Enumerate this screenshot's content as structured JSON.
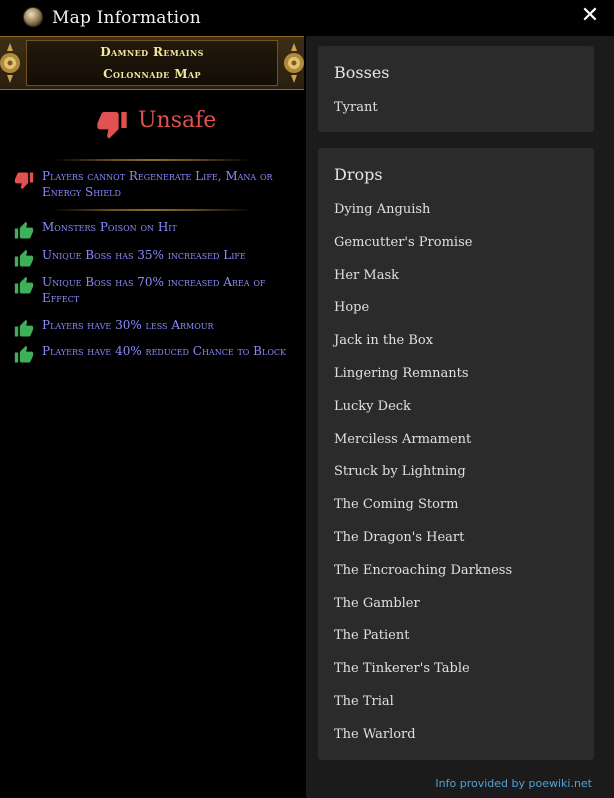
{
  "window": {
    "title": "Map Information",
    "close_glyph": "✕"
  },
  "map": {
    "name": "Damned Remains",
    "type": "Colonnade Map"
  },
  "rating": {
    "label": "Unsafe",
    "icon": "thumbs-down-icon",
    "color": "#e05252"
  },
  "modifiers": [
    {
      "text": "Players cannot Regenerate Life, Mana or Energy Shield",
      "verdict": "bad"
    },
    {
      "text": "Monsters Poison on Hit",
      "verdict": "good"
    },
    {
      "text": "Unique Boss has 35% increased Life",
      "verdict": "good"
    },
    {
      "text": "Unique Boss has 70% increased Area of Effect",
      "verdict": "good"
    },
    {
      "text": "Players have 30% less Armour",
      "verdict": "good"
    },
    {
      "text": "Players have 40% reduced Chance to Block",
      "verdict": "good"
    }
  ],
  "colors": {
    "bad": "#e05252",
    "good": "#3fb05a",
    "modifier_text": "#8a8aff",
    "footer_link": "#4fa3d8"
  },
  "bosses": {
    "heading": "Bosses",
    "items": [
      "Tyrant"
    ]
  },
  "drops": {
    "heading": "Drops",
    "items": [
      "Dying Anguish",
      "Gemcutter's Promise",
      "Her Mask",
      "Hope",
      "Jack in the Box",
      "Lingering Remnants",
      "Lucky Deck",
      "Merciless Armament",
      "Struck by Lightning",
      "The Coming Storm",
      "The Dragon's Heart",
      "The Encroaching Darkness",
      "The Gambler",
      "The Patient",
      "The Tinkerer's Table",
      "The Trial",
      "The Warlord"
    ]
  },
  "footer": {
    "text": "Info provided by poewiki.net"
  }
}
